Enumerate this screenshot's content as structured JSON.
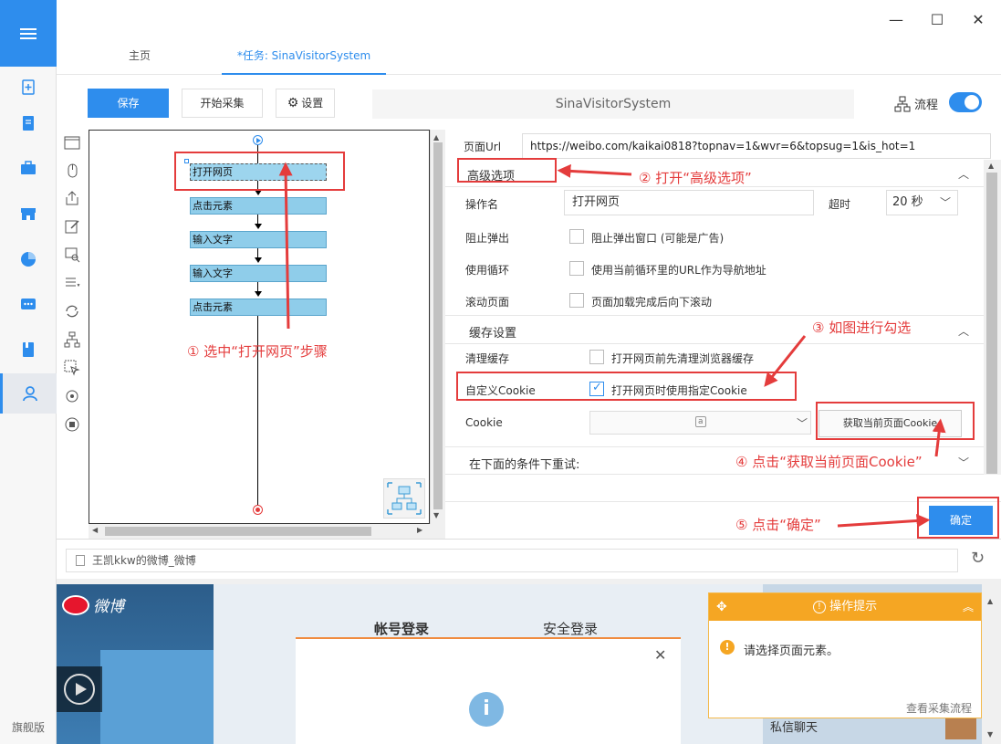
{
  "sidebar": {
    "edition": "旗舰版",
    "icons": [
      "clipboard-add-icon",
      "document-icon",
      "briefcase-icon",
      "store-icon",
      "pie-chart-icon",
      "chat-icon",
      "book-icon",
      "user-icon"
    ]
  },
  "window": {
    "minimize": "—",
    "maximize": "☐",
    "close": "✕"
  },
  "tabs": [
    {
      "label": "主页"
    },
    {
      "label": "*任务: SinaVisitorSystem"
    }
  ],
  "toolbar": {
    "save": "保存",
    "start": "开始采集",
    "settings": "设置",
    "task_name": "SinaVisitorSystem",
    "flow_label": "流程"
  },
  "workflow": {
    "steps": [
      "打开网页",
      "点击元素",
      "输入文字",
      "输入文字",
      "点击元素"
    ]
  },
  "panel": {
    "url_label": "页面Url",
    "url_value": "https://weibo.com/kaikai0818?topnav=1&wvr=6&topsug=1&is_hot=1",
    "advanced": "高级选项",
    "op_name_label": "操作名",
    "op_name_value": "打开网页",
    "timeout_label": "超时",
    "timeout_value": "20 秒",
    "block_popup_label": "阻止弹出",
    "block_popup_text": "阻止弹出窗口 (可能是广告)",
    "use_loop_label": "使用循环",
    "use_loop_text": "使用当前循环里的URL作为导航地址",
    "scroll_label": "滚动页面",
    "scroll_text": "页面加载完成后向下滚动",
    "cache_section": "缓存设置",
    "clear_cache_label": "清理缓存",
    "clear_cache_text": "打开网页前先清理浏览器缓存",
    "custom_cookie_label": "自定义Cookie",
    "custom_cookie_text": "打开网页时使用指定Cookie",
    "cookie_label": "Cookie",
    "get_cookie": "获取当前页面Cookie",
    "retry_section": "在下面的条件下重试:",
    "confirm": "确定"
  },
  "address": {
    "value": "王凯kkw的微博_微博"
  },
  "browser": {
    "logo": "微博",
    "tab_account": "帐号登录",
    "tab_secure": "安全登录",
    "private_chat": "私信聊天"
  },
  "hint": {
    "title": "操作提示",
    "message": "请选择页面元素。",
    "link": "查看采集流程"
  },
  "annotations": {
    "a1": "① 选中“打开网页”步骤",
    "a2": "② 打开“高级选项”",
    "a3": "③ 如图进行勾选",
    "a4": "④ 点击“获取当前页面Cookie”",
    "a5": "⑤ 点击“确定”"
  },
  "colors": {
    "accent": "#2e8ded",
    "annotation": "#e43c3c",
    "step": "#8fcdea",
    "hint": "#f5a623"
  }
}
